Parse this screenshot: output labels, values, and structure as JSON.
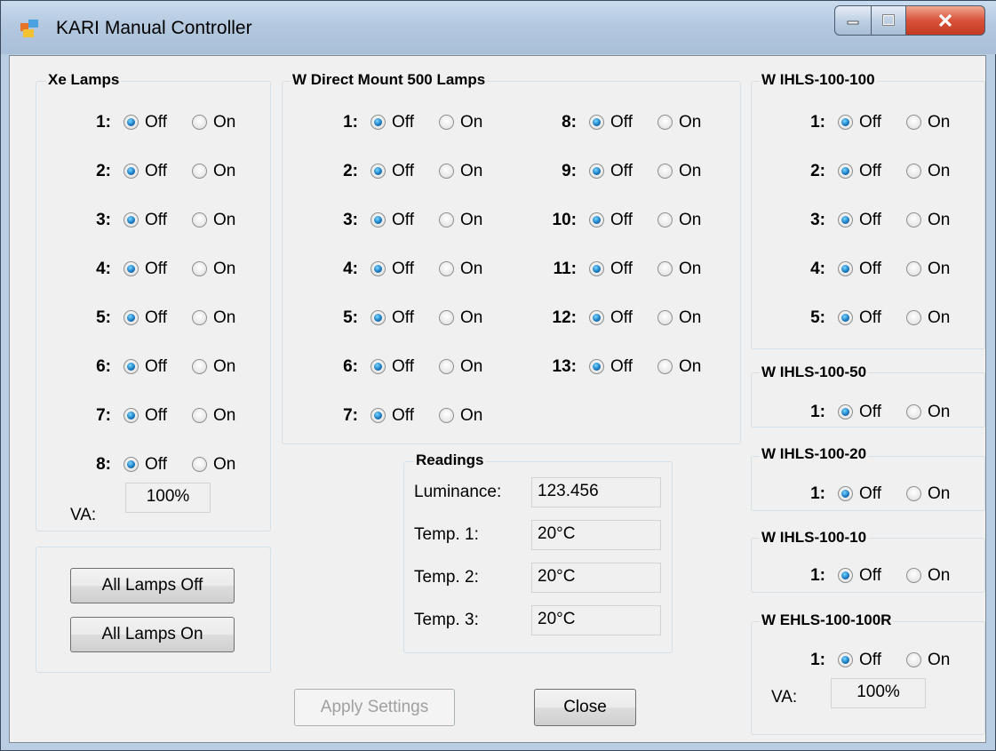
{
  "window": {
    "title": "KARI Manual Controller",
    "controls": {
      "minimize": "minimize-icon",
      "maximize": "maximize-icon",
      "close": "close-icon"
    }
  },
  "labels": {
    "off": "Off",
    "on": "On"
  },
  "xe_lamps": {
    "title": "Xe Lamps",
    "lamps": [
      "1:",
      "2:",
      "3:",
      "4:",
      "5:",
      "6:",
      "7:",
      "8:"
    ],
    "va_label": "VA:",
    "va_value": "100%"
  },
  "all_lamps": {
    "off_label": "All Lamps Off",
    "on_label": "All Lamps On"
  },
  "w_direct": {
    "title": "W Direct Mount 500 Lamps",
    "lamps": [
      "1:",
      "2:",
      "3:",
      "4:",
      "5:",
      "6:",
      "7:",
      "8:",
      "9:",
      "10:",
      "11:",
      "12:",
      "13:"
    ]
  },
  "readings": {
    "title": "Readings",
    "rows": [
      {
        "label": "Luminance:",
        "value": "123.456"
      },
      {
        "label": "Temp. 1:",
        "value": "20°C"
      },
      {
        "label": "Temp. 2:",
        "value": "20°C"
      },
      {
        "label": "Temp. 3:",
        "value": "20°C"
      }
    ]
  },
  "ihls_100_100": {
    "title": "W IHLS-100-100",
    "lamps": [
      "1:",
      "2:",
      "3:",
      "4:",
      "5:"
    ]
  },
  "ihls_100_50": {
    "title": "W IHLS-100-50",
    "lamps": [
      "1:"
    ]
  },
  "ihls_100_20": {
    "title": "W IHLS-100-20",
    "lamps": [
      "1:"
    ]
  },
  "ihls_100_10": {
    "title": "W IHLS-100-10",
    "lamps": [
      "1:"
    ]
  },
  "ehls": {
    "title": "W EHLS-100-100R",
    "lamps": [
      "1:"
    ],
    "va_label": "VA:",
    "va_value": "100%"
  },
  "footer": {
    "apply_label": "Apply Settings",
    "close_label": "Close"
  }
}
